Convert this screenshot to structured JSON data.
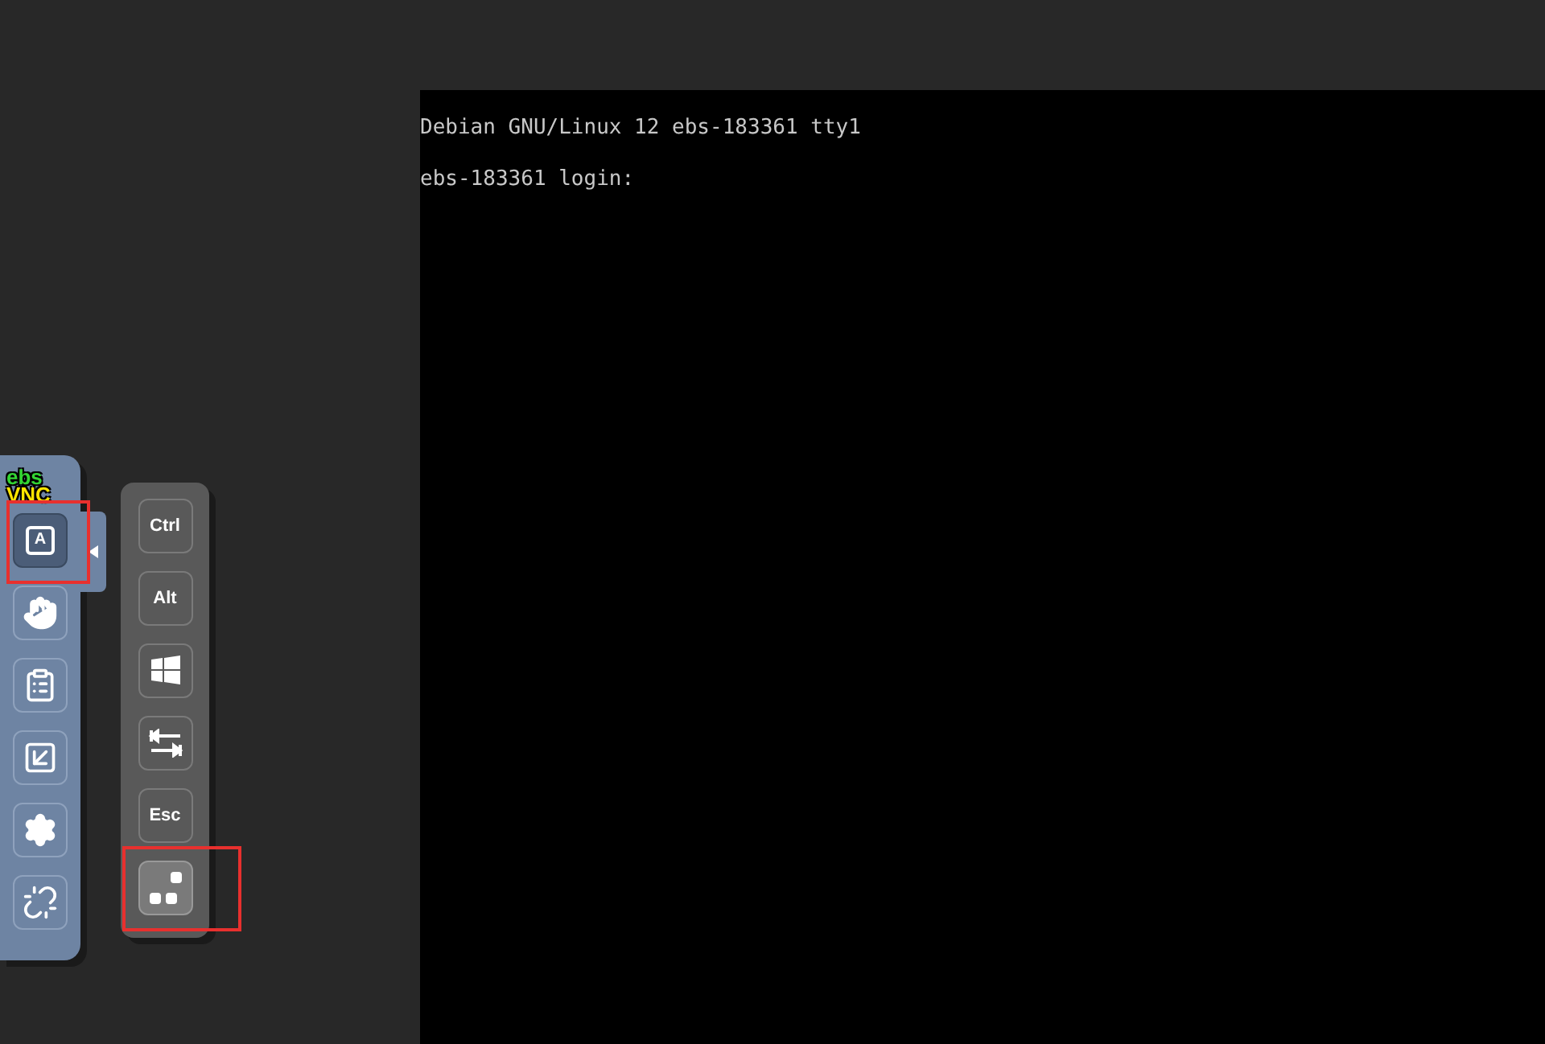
{
  "control_bar": {
    "logo": {
      "part_1": "ebs",
      "part_2": "VNC"
    },
    "buttons": [
      {
        "kind": "keyboard",
        "glyph": "A",
        "selected": true,
        "highlighted": true
      },
      {
        "kind": "drag",
        "selected": false,
        "highlighted": false
      },
      {
        "kind": "clipboard",
        "selected": false,
        "highlighted": false
      },
      {
        "kind": "fullscreen",
        "selected": false,
        "highlighted": false
      },
      {
        "kind": "settings",
        "selected": false,
        "highlighted": false
      },
      {
        "kind": "disconnect",
        "selected": false,
        "highlighted": false
      }
    ]
  },
  "extra_keys": [
    {
      "kind": "text",
      "label": "Ctrl",
      "selected": false,
      "highlighted": false
    },
    {
      "kind": "text",
      "label": "Alt",
      "selected": false,
      "highlighted": false
    },
    {
      "kind": "windows",
      "selected": false,
      "highlighted": false
    },
    {
      "kind": "tab",
      "selected": false,
      "highlighted": false
    },
    {
      "kind": "text",
      "label": "Esc",
      "selected": false,
      "highlighted": false
    },
    {
      "kind": "combo",
      "selected": true,
      "highlighted": true
    }
  ],
  "terminal": {
    "lines": [
      "Debian GNU/Linux 12 ebs-183361 tty1",
      "ebs-183361 login:"
    ]
  }
}
